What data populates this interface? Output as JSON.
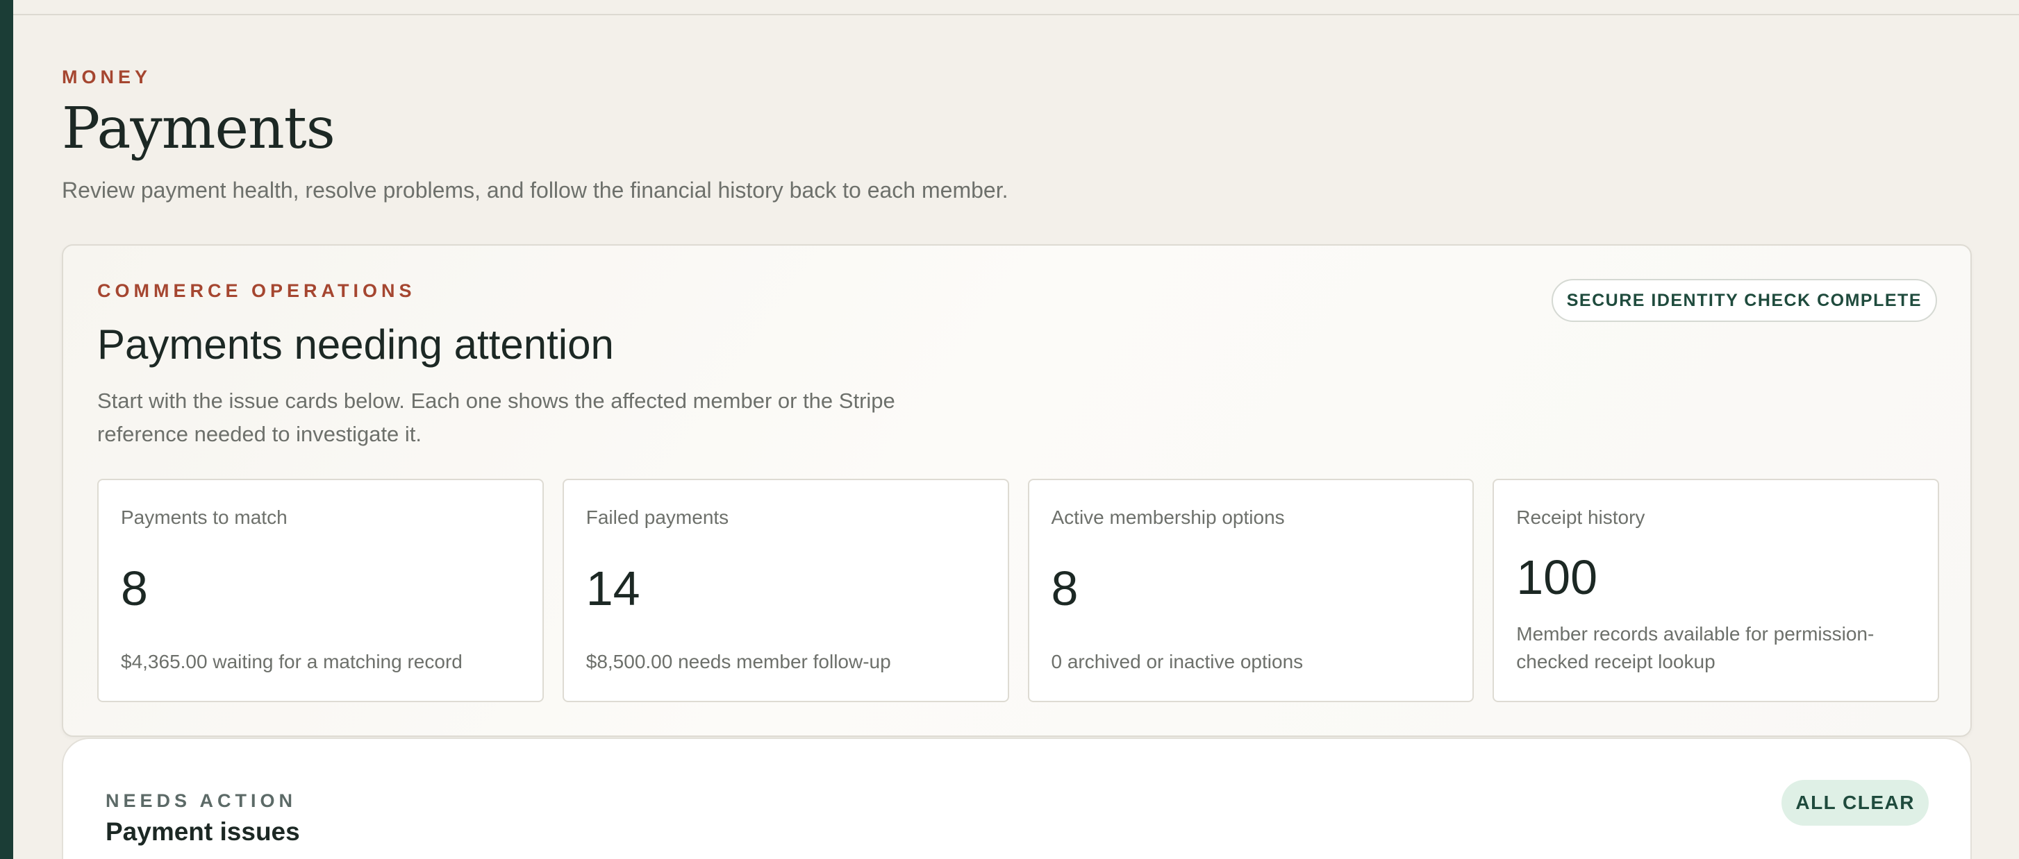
{
  "header": {
    "eyebrow": "MONEY",
    "title": "Payments",
    "description": "Review payment health, resolve problems, and follow the financial history back to each member."
  },
  "operations": {
    "eyebrow": "COMMERCE OPERATIONS",
    "title": "Payments needing attention",
    "description": "Start with the issue cards below. Each one shows the affected member or the Stripe reference needed to investigate it.",
    "status_badge": "SECURE IDENTITY CHECK COMPLETE",
    "metrics": [
      {
        "label": "Payments to match",
        "value": "8",
        "note": "$4,365.00 waiting for a matching record"
      },
      {
        "label": "Failed payments",
        "value": "14",
        "note": "$8,500.00 needs member follow-up"
      },
      {
        "label": "Active membership options",
        "value": "8",
        "note": "0 archived or inactive options"
      },
      {
        "label": "Receipt history",
        "value": "100",
        "note": "Member records available for permission-checked receipt lookup"
      }
    ]
  },
  "issues": {
    "eyebrow": "NEEDS ACTION",
    "title": "Payment issues",
    "status_badge": "ALL CLEAR"
  },
  "colors": {
    "accent": "#a54630",
    "brand_dark": "#1b3d36",
    "background": "#f3f0ea",
    "success_bg": "#dff0e6",
    "success_text": "#1f4b3d"
  }
}
